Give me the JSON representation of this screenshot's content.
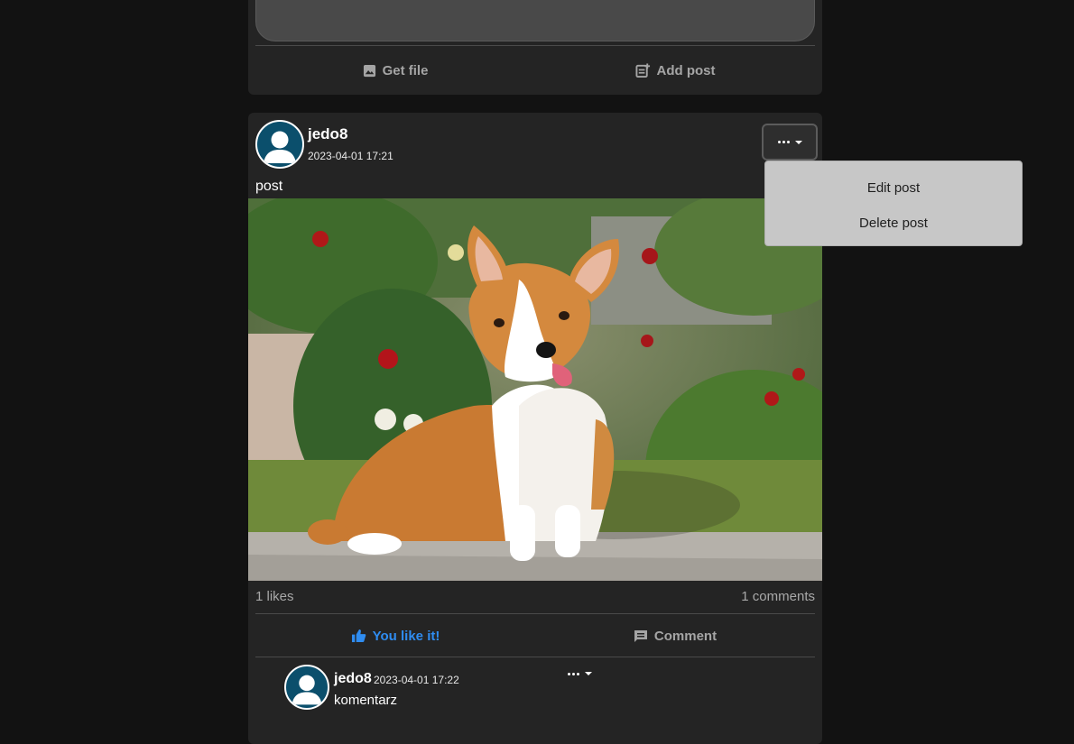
{
  "create_post": {
    "get_file_label": "Get file",
    "add_post_label": "Add post"
  },
  "post": {
    "author": "jedo8",
    "date": "2023-04-01 17:21",
    "text": "post",
    "image_description": "corgi-photo",
    "likes": "1 likes",
    "comments": "1 comments",
    "like_label": "You like it!",
    "comment_label": "Comment"
  },
  "comment": {
    "author": "jedo8",
    "date": "2023-04-01 17:22",
    "text": "komentarz"
  },
  "dropdown": {
    "items": [
      "Edit post",
      "Delete post"
    ]
  },
  "colors": {
    "background": "#121212",
    "card": "#242424",
    "accent_like": "#2f8cf0",
    "avatar": "#0b4f6c",
    "dropdown": "#c7c7c7"
  }
}
